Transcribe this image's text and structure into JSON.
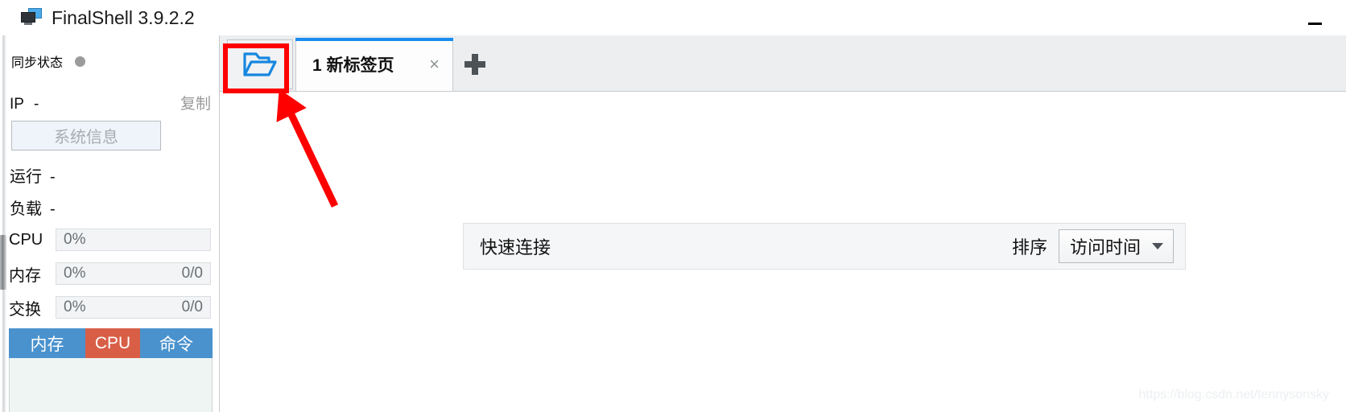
{
  "window": {
    "title": "FinalShell 3.9.2.2",
    "app_icon": "monitor-icon",
    "minimize_label": "—"
  },
  "sidebar": {
    "sync": {
      "label": "同步状态",
      "status_icon": "status-dot",
      "status_color": "#9b9b9b"
    },
    "ip": {
      "key": "IP",
      "value": "-",
      "copy_label": "复制"
    },
    "system_info_button": "系统信息",
    "stats": [
      {
        "key": "运行",
        "value": "-"
      },
      {
        "key": "负载",
        "value": "-"
      }
    ],
    "meters": [
      {
        "label": "CPU",
        "percent": "0%",
        "detail": ""
      },
      {
        "label": "内存",
        "percent": "0%",
        "detail": "0/0"
      },
      {
        "label": "交换",
        "percent": "0%",
        "detail": "0/0"
      }
    ],
    "mini_tabs": [
      {
        "label": "内存",
        "active": false,
        "color": "#4a92cd"
      },
      {
        "label": "CPU",
        "active": true,
        "color": "#d85e46"
      },
      {
        "label": "命令",
        "active": false,
        "color": "#4a92cd"
      }
    ]
  },
  "main": {
    "toolbar": {
      "folder_button_icon": "open-folder-icon"
    },
    "tabs": [
      {
        "label": "1 新标签页",
        "close_icon": "×",
        "active": true
      }
    ],
    "add_tab_icon": "+",
    "quick_connect": {
      "title": "快速连接",
      "sort_label": "排序",
      "sort_value": "访问时间",
      "sort_caret": "chevron-down-icon"
    }
  },
  "watermark": "https://blog.csdn.net/tennysonsky",
  "annotation": {
    "highlight_color": "#ff0000",
    "target": "open-folder-icon"
  }
}
